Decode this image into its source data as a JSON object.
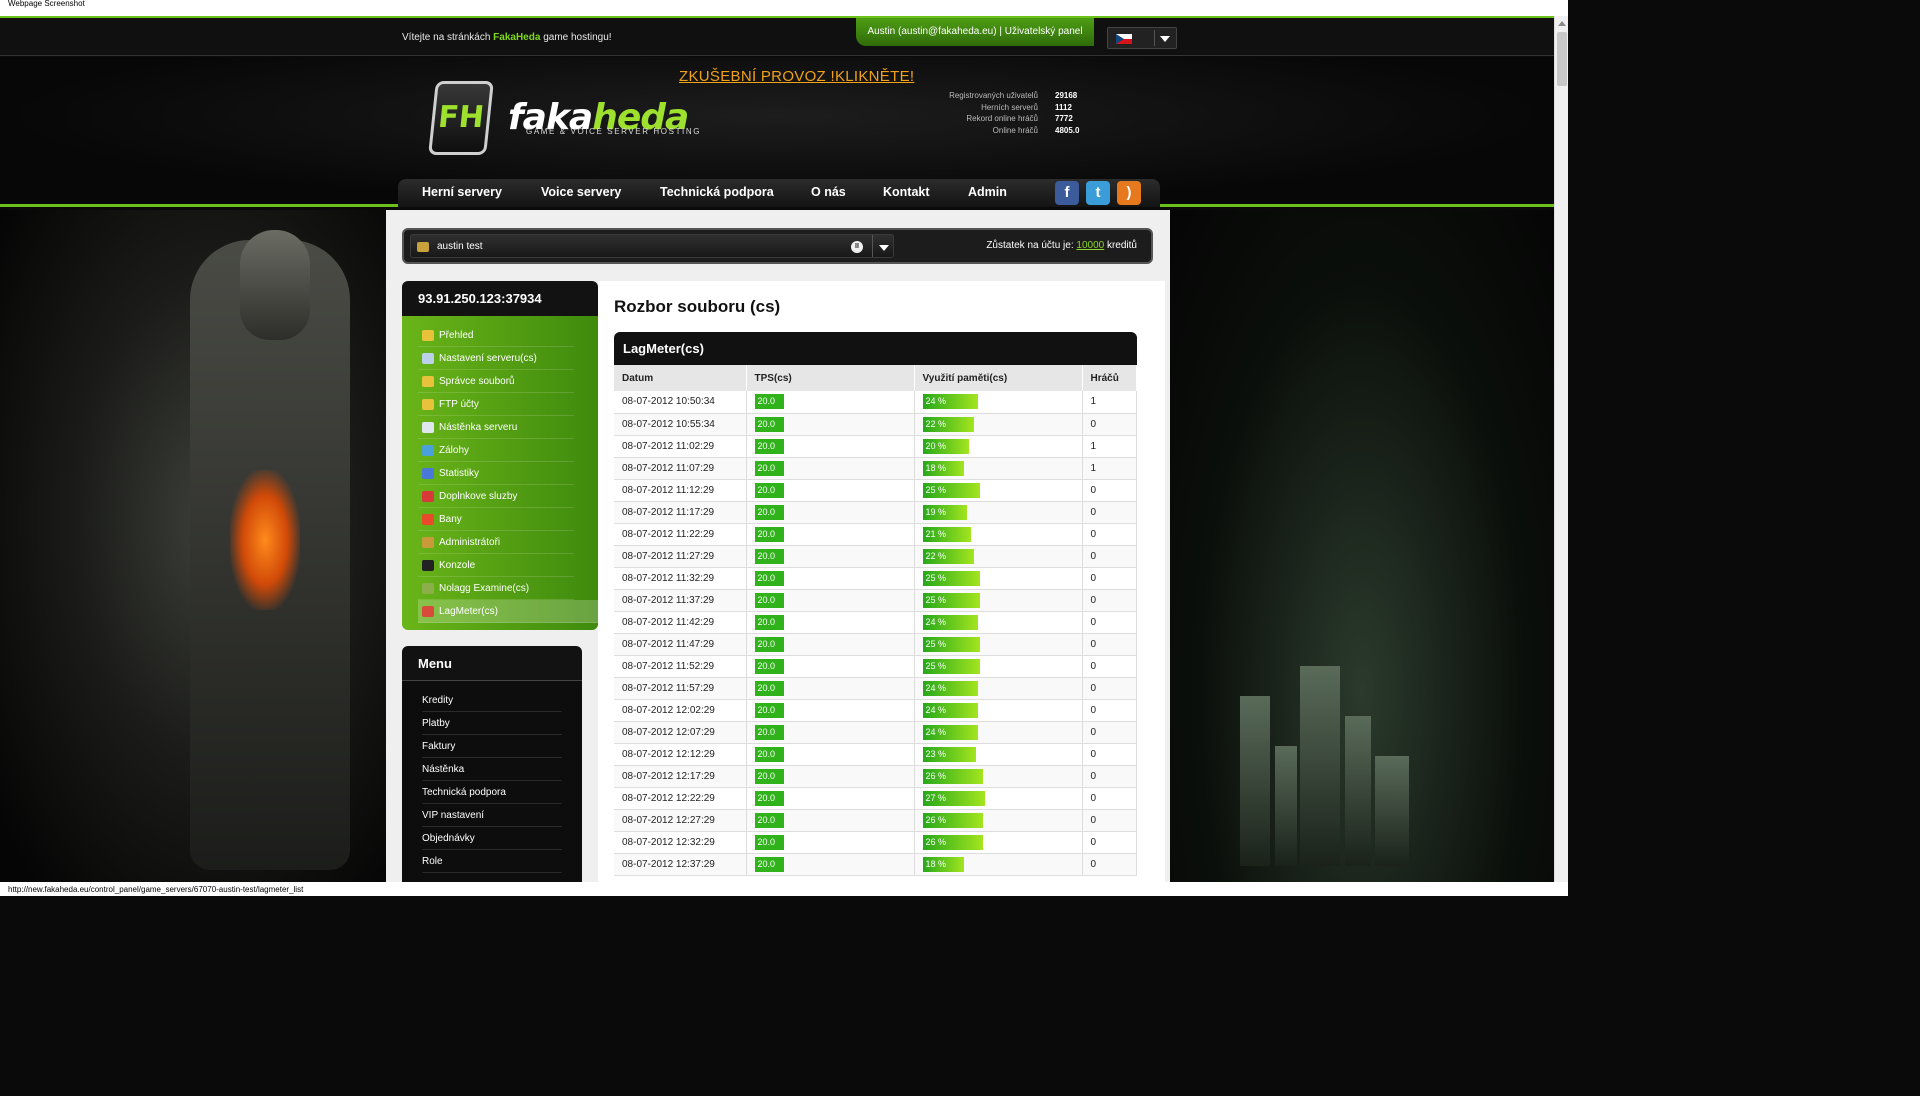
{
  "window_title": "Webpage Screenshot",
  "topbar": {
    "welcome_pre": "Vítejte na stránkách ",
    "welcome_brand": "FakaHeda",
    "welcome_post": " game hostingu!",
    "user": "Austin (austin@fakaheda.eu)",
    "separator": "|",
    "panel_link": "Uživatelský panel",
    "language_flag": "czech-flag-icon"
  },
  "header": {
    "promo": "ZKUŠEBNÍ PROVOZ !KLIKNĚTE!",
    "logo_mark": "FH",
    "logo_text_a": "faka",
    "logo_text_b": "heda",
    "logo_sub": "GAME & VOICE SERVER HOSTING",
    "stats": [
      {
        "label": "Registrovaných uživatelů",
        "value": "29168"
      },
      {
        "label": "Herních serverů",
        "value": "1112"
      },
      {
        "label": "Rekord online hráčů",
        "value": "7772"
      },
      {
        "label": "Online hráčů",
        "value": "4805.0"
      }
    ]
  },
  "nav": {
    "items": [
      "Herní servery",
      "Voice servery",
      "Technická podpora",
      "O nás",
      "Kontakt",
      "Admin"
    ],
    "social": [
      "facebook-icon",
      "twitter-icon",
      "rss-icon"
    ]
  },
  "account": {
    "server_name": "austin test",
    "balance_pre": "Zůstatek na účtu je: ",
    "balance_value": "10000",
    "balance_post": " kreditů"
  },
  "server_menu": {
    "address": "93.91.250.123:37934",
    "items": [
      "Přehled",
      "Nastavení serveru(cs)",
      "Správce souborů",
      "FTP účty",
      "Nástěnka serveru",
      "Zálohy",
      "Statistiky",
      "Doplnkove sluzby",
      "Bany",
      "Administrátoři",
      "Konzole",
      "Nolagg Examine(cs)",
      "LagMeter(cs)"
    ],
    "active_index": 12
  },
  "user_menu": {
    "title": "Menu",
    "items": [
      "Kredity",
      "Platby",
      "Faktury",
      "Nástěnka",
      "Technická podpora",
      "VIP nastavení",
      "Objednávky",
      "Role"
    ]
  },
  "content": {
    "title": "Rozbor souboru (cs)",
    "panel_title": "LagMeter(cs)",
    "columns": [
      "Datum",
      "TPS(cs)",
      "Využití paměti(cs)",
      "Hráčů"
    ],
    "rows": [
      {
        "date": "08-07-2012 10:50:34",
        "tps": "20.0",
        "mem": "24 %",
        "mem_pct": 24,
        "players": "1"
      },
      {
        "date": "08-07-2012 10:55:34",
        "tps": "20.0",
        "mem": "22 %",
        "mem_pct": 22,
        "players": "0"
      },
      {
        "date": "08-07-2012 11:02:29",
        "tps": "20.0",
        "mem": "20 %",
        "mem_pct": 20,
        "players": "1"
      },
      {
        "date": "08-07-2012 11:07:29",
        "tps": "20.0",
        "mem": "18 %",
        "mem_pct": 18,
        "players": "1"
      },
      {
        "date": "08-07-2012 11:12:29",
        "tps": "20.0",
        "mem": "25 %",
        "mem_pct": 25,
        "players": "0"
      },
      {
        "date": "08-07-2012 11:17:29",
        "tps": "20.0",
        "mem": "19 %",
        "mem_pct": 19,
        "players": "0"
      },
      {
        "date": "08-07-2012 11:22:29",
        "tps": "20.0",
        "mem": "21 %",
        "mem_pct": 21,
        "players": "0"
      },
      {
        "date": "08-07-2012 11:27:29",
        "tps": "20.0",
        "mem": "22 %",
        "mem_pct": 22,
        "players": "0"
      },
      {
        "date": "08-07-2012 11:32:29",
        "tps": "20.0",
        "mem": "25 %",
        "mem_pct": 25,
        "players": "0"
      },
      {
        "date": "08-07-2012 11:37:29",
        "tps": "20.0",
        "mem": "25 %",
        "mem_pct": 25,
        "players": "0"
      },
      {
        "date": "08-07-2012 11:42:29",
        "tps": "20.0",
        "mem": "24 %",
        "mem_pct": 24,
        "players": "0"
      },
      {
        "date": "08-07-2012 11:47:29",
        "tps": "20.0",
        "mem": "25 %",
        "mem_pct": 25,
        "players": "0"
      },
      {
        "date": "08-07-2012 11:52:29",
        "tps": "20.0",
        "mem": "25 %",
        "mem_pct": 25,
        "players": "0"
      },
      {
        "date": "08-07-2012 11:57:29",
        "tps": "20.0",
        "mem": "24 %",
        "mem_pct": 24,
        "players": "0"
      },
      {
        "date": "08-07-2012 12:02:29",
        "tps": "20.0",
        "mem": "24 %",
        "mem_pct": 24,
        "players": "0"
      },
      {
        "date": "08-07-2012 12:07:29",
        "tps": "20.0",
        "mem": "24 %",
        "mem_pct": 24,
        "players": "0"
      },
      {
        "date": "08-07-2012 12:12:29",
        "tps": "20.0",
        "mem": "23 %",
        "mem_pct": 23,
        "players": "0"
      },
      {
        "date": "08-07-2012 12:17:29",
        "tps": "20.0",
        "mem": "26 %",
        "mem_pct": 26,
        "players": "0"
      },
      {
        "date": "08-07-2012 12:22:29",
        "tps": "20.0",
        "mem": "27 %",
        "mem_pct": 27,
        "players": "0"
      },
      {
        "date": "08-07-2012 12:27:29",
        "tps": "20.0",
        "mem": "26 %",
        "mem_pct": 26,
        "players": "0"
      },
      {
        "date": "08-07-2012 12:32:29",
        "tps": "20.0",
        "mem": "26 %",
        "mem_pct": 26,
        "players": "0"
      },
      {
        "date": "08-07-2012 12:37:29",
        "tps": "20.0",
        "mem": "18 %",
        "mem_pct": 18,
        "players": "0"
      }
    ]
  },
  "statusbar": "http://new.fakaheda.eu/control_panel/game_servers/67070-austin-test/lagmeter_list",
  "colors": {
    "accent": "#6cc21a",
    "promo": "#f0a21a",
    "tps": "#2fb21a"
  }
}
